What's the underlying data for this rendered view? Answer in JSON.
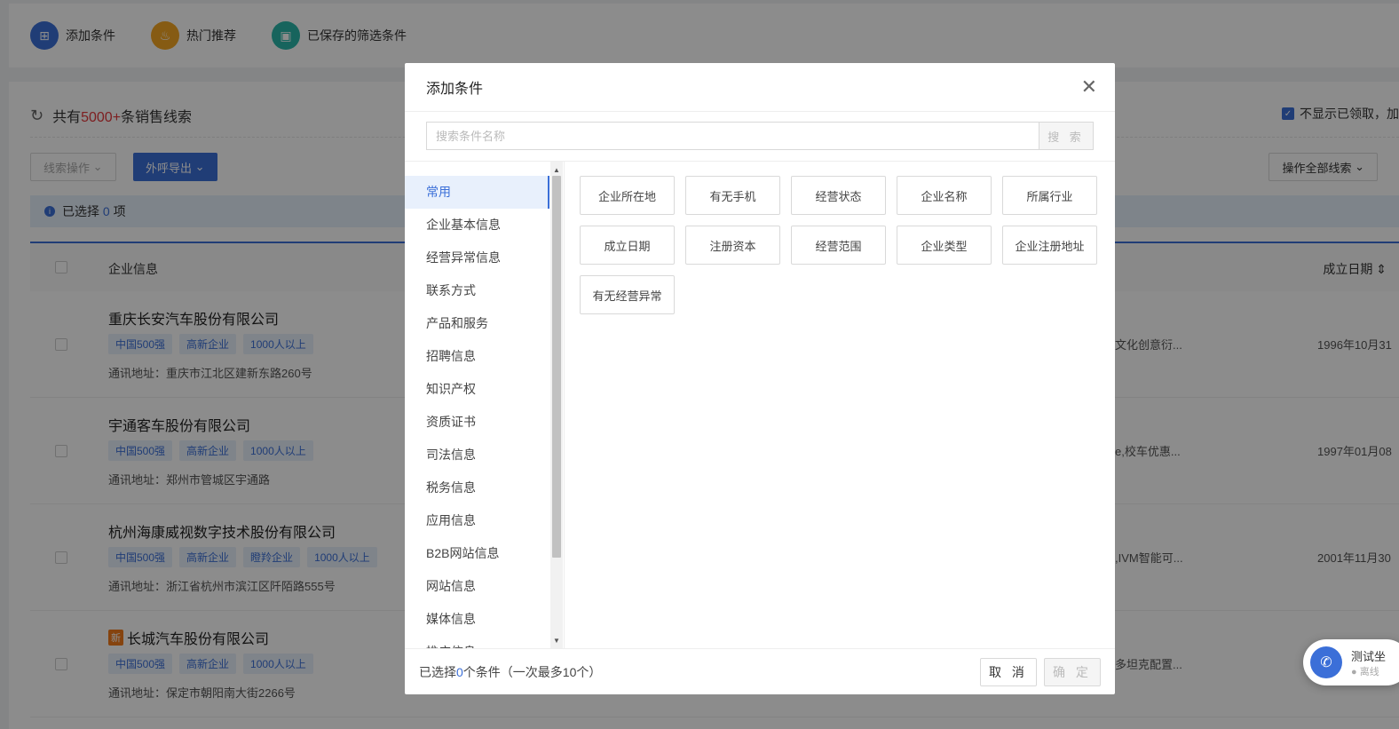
{
  "topbar": {
    "items": [
      {
        "label": "添加条件",
        "icon": "plus-square-icon",
        "color": "#3b6fd8"
      },
      {
        "label": "热门推荐",
        "icon": "flame-icon",
        "color": "#f5a623"
      },
      {
        "label": "已保存的筛选条件",
        "icon": "inbox-icon",
        "color": "#2ab7a9"
      }
    ]
  },
  "summary": {
    "prefix": "共有",
    "count": "5000+",
    "suffix": "条销售线索"
  },
  "hide_claimed_label": "不显示已领取，加",
  "toolbar": {
    "lead_ops": "线索操作",
    "call_export": "外呼导出",
    "op_all": "操作全部线索"
  },
  "selection": {
    "prefix": "已选择",
    "count": "0",
    "suffix": "项"
  },
  "table": {
    "col_company": "企业信息",
    "col_date": "成立日期",
    "addr_label": "通讯地址：",
    "rows": [
      {
        "name": "重庆长安汽车股份有限公司",
        "is_new": false,
        "tags": [
          "中国500强",
          "高新企业",
          "1000人以上"
        ],
        "address": "重庆市江北区建新东路260号",
        "scope": "文化创意衍...",
        "date": "1996年10月31"
      },
      {
        "name": "宇通客车股份有限公司",
        "is_new": false,
        "tags": [
          "中国500强",
          "高新企业",
          "1000人以上"
        ],
        "address": "郑州市管城区宇通路",
        "scope": "e,校车优惠...",
        "date": "1997年01月08"
      },
      {
        "name": "杭州海康威视数字技术股份有限公司",
        "is_new": false,
        "tags": [
          "中国500强",
          "高新企业",
          "瞪羚企业",
          "1000人以上"
        ],
        "address": "浙江省杭州市滨江区阡陌路555号",
        "scope": ",IVM智能可...",
        "date": "2001年11月30"
      },
      {
        "name": "长城汽车股份有限公司",
        "is_new": true,
        "tags": [
          "中国500强",
          "高新企业",
          "1000人以上"
        ],
        "address": "保定市朝阳南大街2266号",
        "scope": "多坦克配置...",
        "date": ""
      }
    ],
    "new_badge": "新"
  },
  "float_call": {
    "title": "测试坐",
    "status": "离线"
  },
  "modal": {
    "title": "添加条件",
    "search_placeholder": "搜索条件名称",
    "search_btn": "搜 索",
    "categories": [
      "常用",
      "企业基本信息",
      "经营异常信息",
      "联系方式",
      "产品和服务",
      "招聘信息",
      "知识产权",
      "资质证书",
      "司法信息",
      "税务信息",
      "应用信息",
      "B2B网站信息",
      "网站信息",
      "媒体信息",
      "推广信息"
    ],
    "active_category": 0,
    "conditions": [
      "企业所在地",
      "有无手机",
      "经营状态",
      "企业名称",
      "所属行业",
      "成立日期",
      "注册资本",
      "经营范围",
      "企业类型",
      "企业注册地址",
      "有无经营异常"
    ],
    "footer": {
      "prefix": "已选择",
      "count": "0",
      "suffix": "个条件（一次最多10个）",
      "cancel": "取 消",
      "confirm": "确 定"
    }
  }
}
